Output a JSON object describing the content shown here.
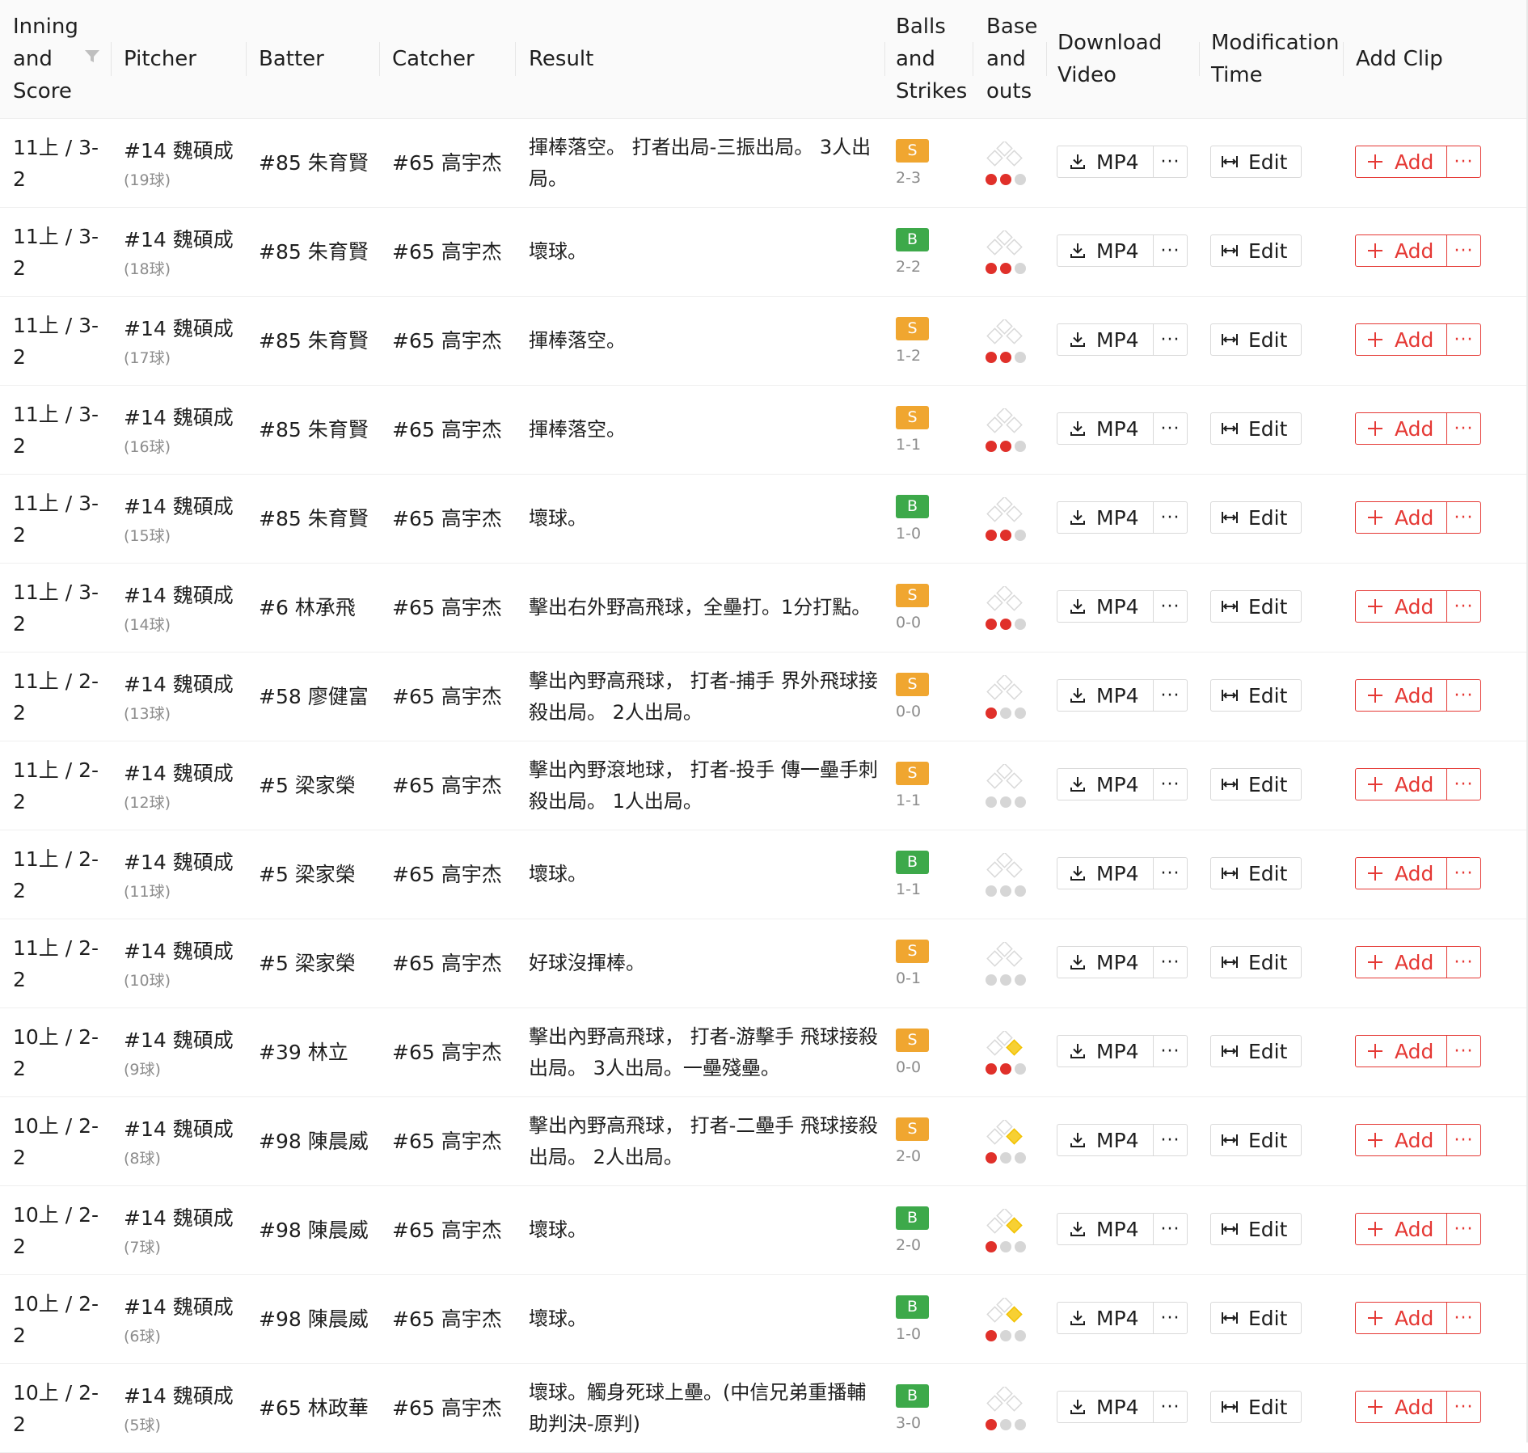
{
  "headers": {
    "inning": "Inning\nand\nScore",
    "pitcher": "Pitcher",
    "batter": "Batter",
    "catcher": "Catcher",
    "result": "Result",
    "balls_strikes": "Balls\nand\nStrikes",
    "base_outs": "Base\nand\nouts",
    "download": "Download\nVideo",
    "modification": "Modification\nTime",
    "add_clip": "Add Clip"
  },
  "labels": {
    "mp4": "MP4",
    "edit": "Edit",
    "add": "Add",
    "more": "···"
  },
  "colors": {
    "strike": "#f0a630",
    "ball": "#3da94a",
    "out_on": "#e0302a",
    "out_off": "#d6d6d6",
    "base_occupied": "#f7d033",
    "accent": "#e53935"
  },
  "rows": [
    {
      "inning": "11上 / 3-\n2",
      "pitcher": "#14 魏碩成",
      "pitch": "(19球)",
      "batter": "#85 朱育賢",
      "catcher": "#65 高宇杰",
      "result": "揮棒落空。 打者出局-三振出局。 3人出局。",
      "call": "S",
      "count": "2-3",
      "outs": 2,
      "bases": [
        false,
        false,
        false
      ]
    },
    {
      "inning": "11上 / 3-\n2",
      "pitcher": "#14 魏碩成",
      "pitch": "(18球)",
      "batter": "#85 朱育賢",
      "catcher": "#65 高宇杰",
      "result": "壞球。",
      "call": "B",
      "count": "2-2",
      "outs": 2,
      "bases": [
        false,
        false,
        false
      ]
    },
    {
      "inning": "11上 / 3-\n2",
      "pitcher": "#14 魏碩成",
      "pitch": "(17球)",
      "batter": "#85 朱育賢",
      "catcher": "#65 高宇杰",
      "result": "揮棒落空。",
      "call": "S",
      "count": "1-2",
      "outs": 2,
      "bases": [
        false,
        false,
        false
      ]
    },
    {
      "inning": "11上 / 3-\n2",
      "pitcher": "#14 魏碩成",
      "pitch": "(16球)",
      "batter": "#85 朱育賢",
      "catcher": "#65 高宇杰",
      "result": "揮棒落空。",
      "call": "S",
      "count": "1-1",
      "outs": 2,
      "bases": [
        false,
        false,
        false
      ]
    },
    {
      "inning": "11上 / 3-\n2",
      "pitcher": "#14 魏碩成",
      "pitch": "(15球)",
      "batter": "#85 朱育賢",
      "catcher": "#65 高宇杰",
      "result": "壞球。",
      "call": "B",
      "count": "1-0",
      "outs": 2,
      "bases": [
        false,
        false,
        false
      ]
    },
    {
      "inning": "11上 / 3-\n2",
      "pitcher": "#14 魏碩成",
      "pitch": "(14球)",
      "batter": "#6 林承飛",
      "catcher": "#65 高宇杰",
      "result": "擊出右外野高飛球，全壘打。1分打點。",
      "call": "S",
      "count": "0-0",
      "outs": 2,
      "bases": [
        false,
        false,
        false
      ]
    },
    {
      "inning": "11上 / 2-\n2",
      "pitcher": "#14 魏碩成",
      "pitch": "(13球)",
      "batter": "#58 廖健富",
      "catcher": "#65 高宇杰",
      "result": "擊出內野高飛球， 打者-捕手 界外飛球接殺出局。 2人出局。",
      "call": "S",
      "count": "0-0",
      "outs": 1,
      "bases": [
        false,
        false,
        false
      ]
    },
    {
      "inning": "11上 / 2-\n2",
      "pitcher": "#14 魏碩成",
      "pitch": "(12球)",
      "batter": "#5 梁家榮",
      "catcher": "#65 高宇杰",
      "result": "擊出內野滾地球， 打者-投手 傳一壘手刺殺出局。 1人出局。",
      "call": "S",
      "count": "1-1",
      "outs": 0,
      "bases": [
        false,
        false,
        false
      ]
    },
    {
      "inning": "11上 / 2-\n2",
      "pitcher": "#14 魏碩成",
      "pitch": "(11球)",
      "batter": "#5 梁家榮",
      "catcher": "#65 高宇杰",
      "result": "壞球。",
      "call": "B",
      "count": "1-1",
      "outs": 0,
      "bases": [
        false,
        false,
        false
      ]
    },
    {
      "inning": "11上 / 2-\n2",
      "pitcher": "#14 魏碩成",
      "pitch": "(10球)",
      "batter": "#5 梁家榮",
      "catcher": "#65 高宇杰",
      "result": "好球沒揮棒。",
      "call": "S",
      "count": "0-1",
      "outs": 0,
      "bases": [
        false,
        false,
        false
      ]
    },
    {
      "inning": "10上 / 2-\n2",
      "pitcher": "#14 魏碩成",
      "pitch": "(9球)",
      "batter": "#39 林立",
      "catcher": "#65 高宇杰",
      "result": "擊出內野高飛球， 打者-游擊手 飛球接殺出局。 3人出局。一壘殘壘。",
      "call": "S",
      "count": "0-0",
      "outs": 2,
      "bases": [
        true,
        false,
        false
      ]
    },
    {
      "inning": "10上 / 2-\n2",
      "pitcher": "#14 魏碩成",
      "pitch": "(8球)",
      "batter": "#98 陳晨威",
      "catcher": "#65 高宇杰",
      "result": "擊出內野高飛球， 打者-二壘手 飛球接殺出局。 2人出局。",
      "call": "S",
      "count": "2-0",
      "outs": 1,
      "bases": [
        true,
        false,
        false
      ]
    },
    {
      "inning": "10上 / 2-\n2",
      "pitcher": "#14 魏碩成",
      "pitch": "(7球)",
      "batter": "#98 陳晨威",
      "catcher": "#65 高宇杰",
      "result": "壞球。",
      "call": "B",
      "count": "2-0",
      "outs": 1,
      "bases": [
        true,
        false,
        false
      ]
    },
    {
      "inning": "10上 / 2-\n2",
      "pitcher": "#14 魏碩成",
      "pitch": "(6球)",
      "batter": "#98 陳晨威",
      "catcher": "#65 高宇杰",
      "result": "壞球。",
      "call": "B",
      "count": "1-0",
      "outs": 1,
      "bases": [
        true,
        false,
        false
      ]
    },
    {
      "inning": "10上 / 2-\n2",
      "pitcher": "#14 魏碩成",
      "pitch": "(5球)",
      "batter": "#65 林政華",
      "catcher": "#65 高宇杰",
      "result": "壞球。觸身死球上壘。(中信兄弟重播輔助判決-原判)",
      "call": "B",
      "count": "3-0",
      "outs": 1,
      "bases": [
        false,
        false,
        false
      ]
    }
  ]
}
